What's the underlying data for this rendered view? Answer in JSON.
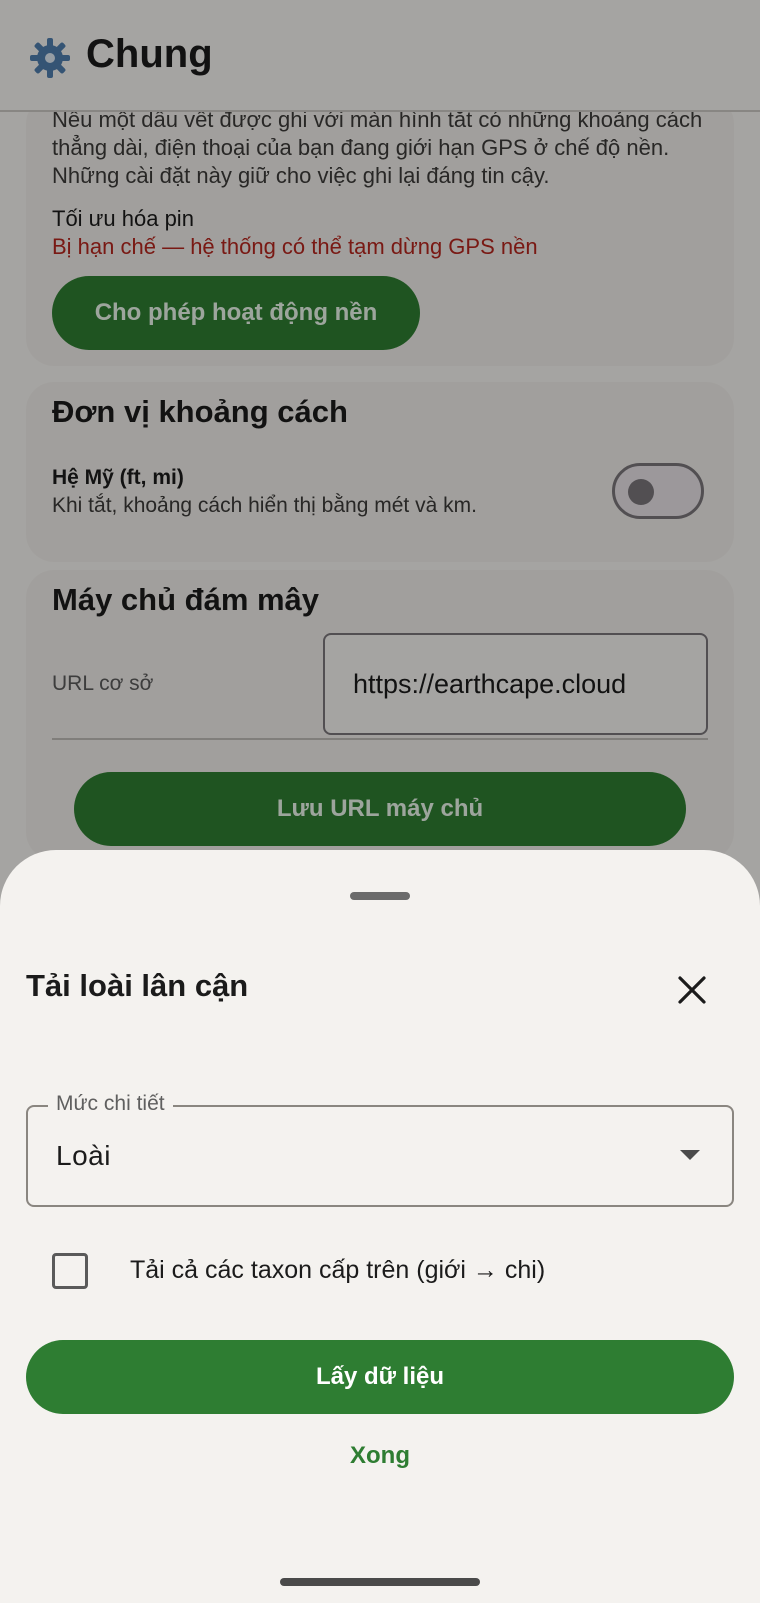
{
  "app_bar": {
    "title": "Chung",
    "icon": "gear-icon"
  },
  "background_settings": {
    "description": "Nếu một dấu vết được ghi với màn hình tắt có những khoảng cách thẳng dài, điện thoại của bạn đang giới hạn GPS ở chế độ nền. Những cài đặt này giữ cho việc ghi lại đáng tin cậy.",
    "battery_label": "Tối ưu hóa pin",
    "battery_status": "Bị hạn chế — hệ thống có thể tạm dừng GPS nền",
    "allow_button": "Cho phép hoạt động nền"
  },
  "distance_units": {
    "title": "Đơn vị khoảng cách",
    "toggle_label": "Hệ Mỹ (ft, mi)",
    "toggle_desc": "Khi tắt, khoảng cách hiển thị bằng mét và km.",
    "toggle_on": false
  },
  "cloud_server": {
    "title": "Máy chủ đám mây",
    "url_label": "URL cơ sở",
    "url_value": "https://earthcape.cloud",
    "save_button": "Lưu URL máy chủ"
  },
  "sheet": {
    "title": "Tải loài lân cận",
    "detail_label": "Mức chi tiết",
    "detail_value": "Loài",
    "checkbox_label": "Tải cả các taxon cấp trên (giới → chi)",
    "checkbox_checked": false,
    "fetch_button": "Lấy dữ liệu",
    "done_button": "Xong"
  },
  "colors": {
    "accent": "#2e7d32",
    "warning": "#b3261e",
    "surface": "#f4f2ef"
  }
}
